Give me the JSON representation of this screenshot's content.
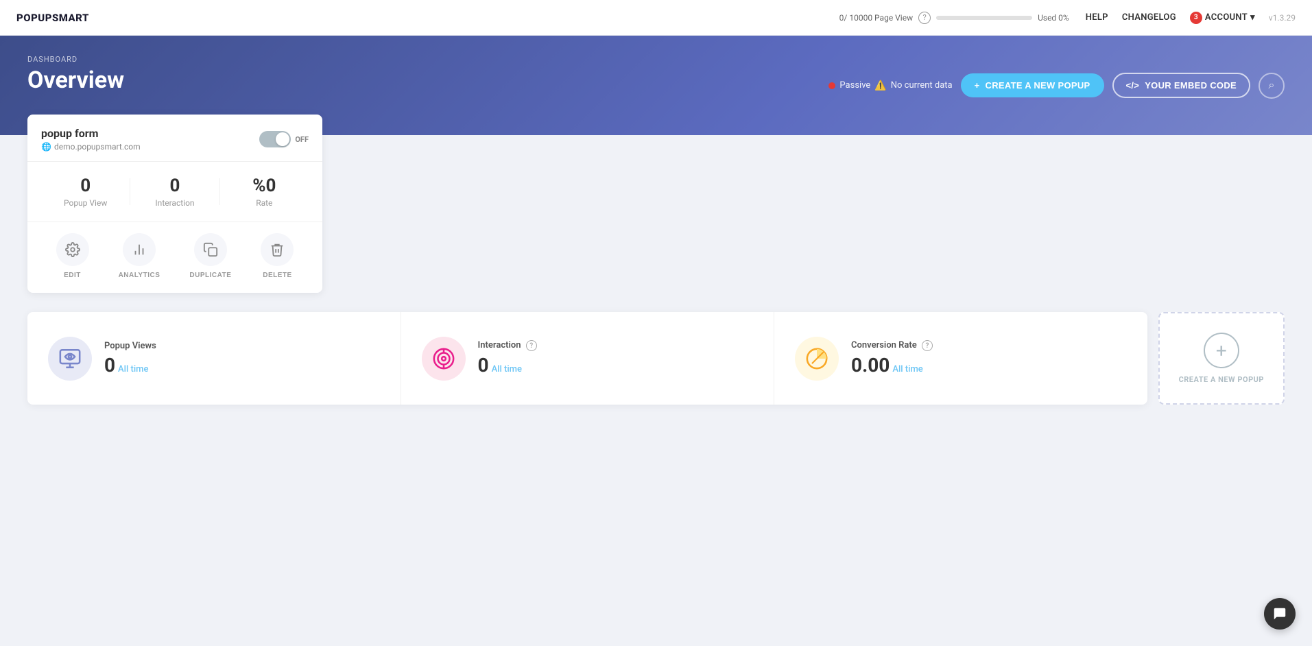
{
  "app": {
    "logo": "POPUPSMART",
    "version": "v1.3.29"
  },
  "topbar": {
    "page_view_label": "0/ 10000 Page View",
    "used_label": "Used 0%",
    "help_label": "HELP",
    "changelog_label": "CHANGELOG",
    "account_label": "ACCOUNT",
    "account_count": "3",
    "bar_percent": 0
  },
  "header": {
    "breadcrumb": "DASHBOARD",
    "title": "Overview",
    "status_text": "Passive",
    "status_warning": "No current data",
    "create_btn": "CREATE A NEW POPUP",
    "embed_btn": "YOUR EMBED CODE"
  },
  "popup_card": {
    "title": "popup form",
    "url": "demo.popupsmart.com",
    "toggle_label": "OFF",
    "stats": [
      {
        "value": "0",
        "label": "Popup View"
      },
      {
        "value": "0",
        "label": "Interaction"
      },
      {
        "value": "%0",
        "label": "Rate"
      }
    ],
    "actions": [
      {
        "label": "EDIT",
        "icon": "⚙"
      },
      {
        "label": "ANALYTICS",
        "icon": "📊"
      },
      {
        "label": "DUPLICATE",
        "icon": "⧉"
      },
      {
        "label": "DELETE",
        "icon": "🗑"
      }
    ]
  },
  "stats": {
    "popup_views": {
      "label": "Popup Views",
      "value": "0",
      "time": "All time"
    },
    "interaction": {
      "label": "Interaction",
      "value": "0",
      "time": "All time"
    },
    "conversion": {
      "label": "Conversion Rate",
      "value": "0.00",
      "time": "All time"
    }
  },
  "create_card": {
    "label": "CREATE A NEW POPUP"
  },
  "icons": {
    "search": "🔍",
    "globe": "🌐",
    "plus": "+",
    "code": "</>",
    "eye": "👁",
    "target": "◎",
    "pie": "◔",
    "question": "?",
    "chat": "💬"
  }
}
